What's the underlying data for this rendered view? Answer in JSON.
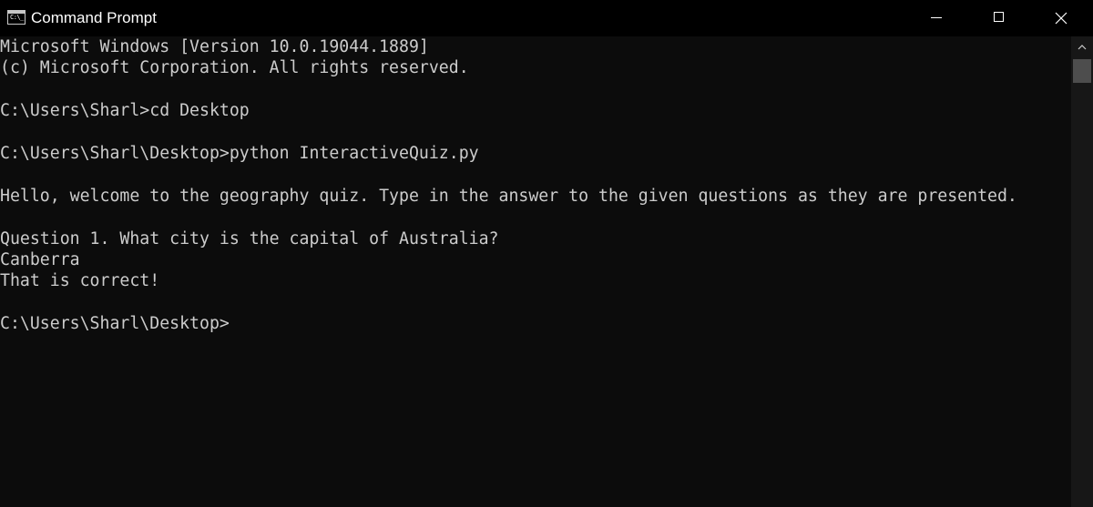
{
  "window": {
    "title": "Command Prompt",
    "icons": {
      "app": "command-prompt-icon",
      "minimize": "minimize-icon",
      "maximize": "maximize-icon",
      "close": "close-icon",
      "scroll_up": "chevron-up-icon"
    },
    "colors": {
      "titlebar": "#000000",
      "console_bg": "#0c0c0c",
      "text": "#cccccc",
      "scroll_track": "#171717",
      "scroll_thumb": "#4d4d4d"
    }
  },
  "console": {
    "lines": [
      "Microsoft Windows [Version 10.0.19044.1889]",
      "(c) Microsoft Corporation. All rights reserved.",
      "",
      "C:\\Users\\Sharl>cd Desktop",
      "",
      "C:\\Users\\Sharl\\Desktop>python InteractiveQuiz.py",
      "",
      "Hello, welcome to the geography quiz. Type in the answer to the given questions as they are presented.",
      "",
      "Question 1. What city is the capital of Australia?",
      "Canberra",
      "That is correct!",
      "",
      "C:\\Users\\Sharl\\Desktop>"
    ]
  }
}
